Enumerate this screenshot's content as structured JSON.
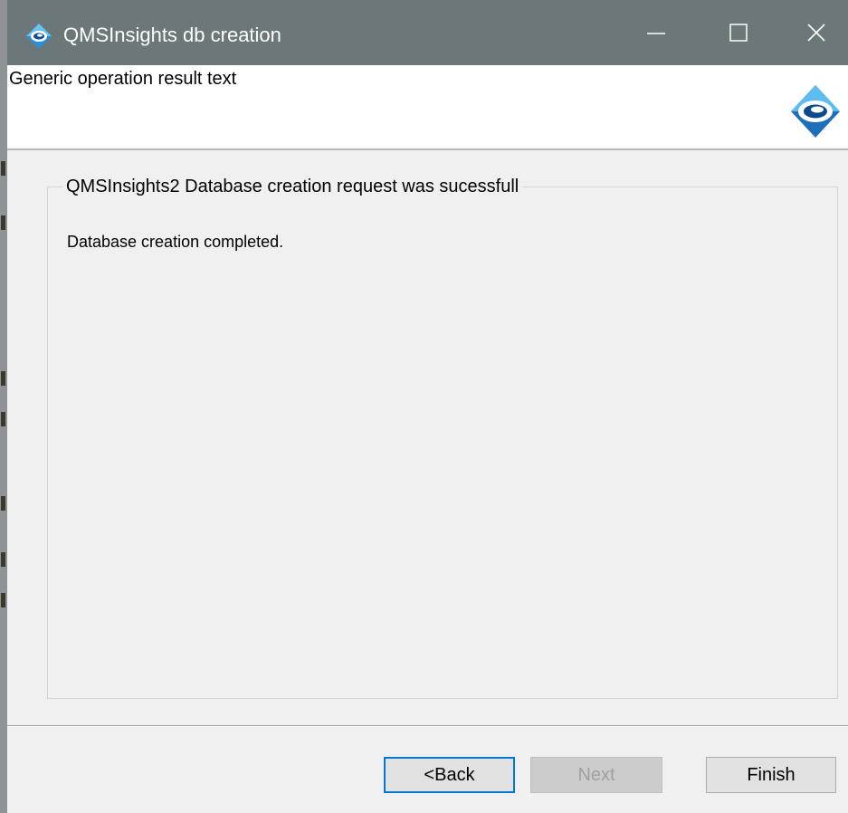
{
  "window": {
    "title": "QMSInsights db creation"
  },
  "header": {
    "text": "Generic operation result text"
  },
  "group": {
    "legend": "QMSInsights2 Database creation request was sucessfull",
    "message": "Database creation completed."
  },
  "buttons": {
    "back": "<Back",
    "next": "Next",
    "finish": "Finish"
  },
  "icons": {
    "app": "app-logo-icon",
    "minimize": "minimize-icon",
    "maximize": "maximize-icon",
    "close": "close-icon"
  },
  "colors": {
    "titlebar": "#6b7779",
    "accent_focus": "#0078d7",
    "logo_blue": "#2a8fd6"
  }
}
